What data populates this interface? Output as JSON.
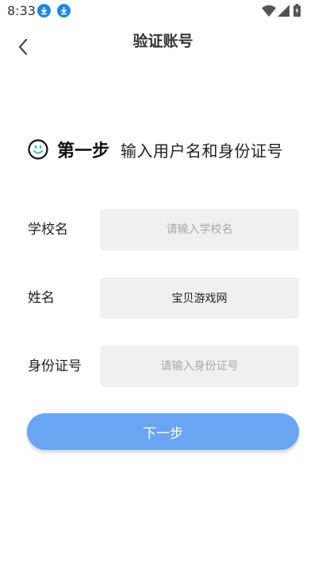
{
  "status_bar": {
    "time": "8:33",
    "icons": [
      "download-icon",
      "download-icon",
      "wifi-icon",
      "signal-icon",
      "battery-icon"
    ],
    "accent_color": "#1e88e5"
  },
  "header": {
    "title": "验证账号",
    "back_icon": "chevron-left-icon"
  },
  "step": {
    "icon": "smile-icon",
    "label": "第一步",
    "description": "输入用户名和身份证号"
  },
  "form": {
    "school": {
      "label": "学校名",
      "value": "",
      "placeholder": "请输入学校名"
    },
    "name": {
      "label": "姓名",
      "value": "宝贝游戏网",
      "placeholder": ""
    },
    "id_number": {
      "label": "身份证号",
      "value": "",
      "placeholder": "请输入身份证号"
    }
  },
  "next_button": {
    "label": "下一步",
    "color": "#6aa5f2"
  }
}
